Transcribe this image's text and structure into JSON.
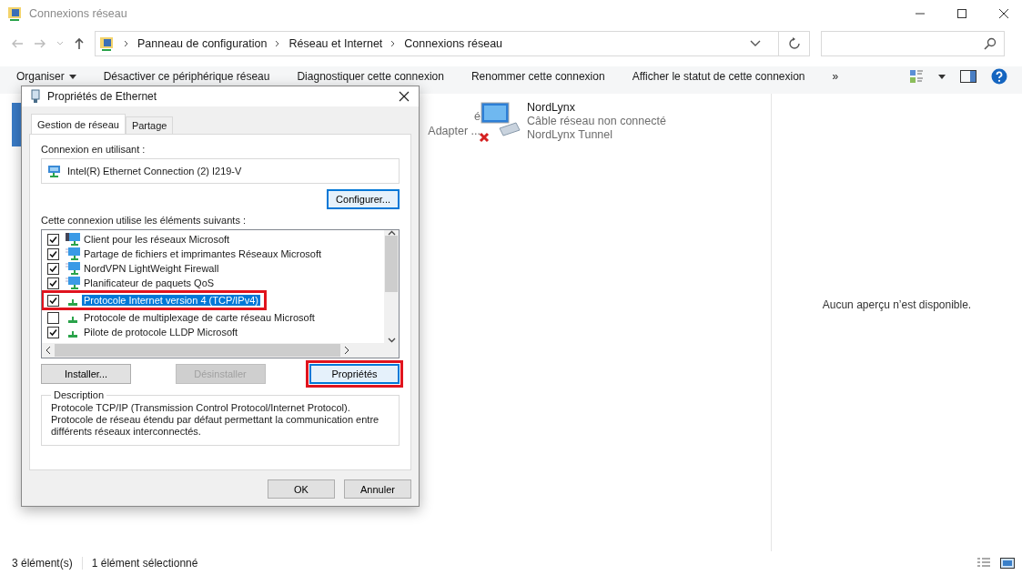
{
  "window": {
    "title": "Connexions réseau"
  },
  "address_bar": {
    "breadcrumbs": [
      "Panneau de configuration",
      "Réseau et Internet",
      "Connexions réseau"
    ]
  },
  "toolbar": {
    "items": [
      "Organiser",
      "Désactiver ce périphérique réseau",
      "Diagnostiquer cette connexion",
      "Renommer cette connexion",
      "Afficher le statut de cette connexion"
    ],
    "more": "»"
  },
  "connections": [
    {
      "kind": "hidden",
      "lines": [
        "é",
        "Adapter ..."
      ]
    },
    {
      "kind": "disconnected",
      "name": "NordLynx",
      "lines": [
        "Câble réseau non connecté",
        "NordLynx Tunnel"
      ]
    }
  ],
  "preview": {
    "message": "Aucun aperçu n’est disponible."
  },
  "status_bar": {
    "count": "3 élément(s)",
    "selection": "1 élément sélectionné"
  },
  "dialog": {
    "title": "Propriétés de Ethernet",
    "tabs": [
      {
        "label": "Gestion de réseau",
        "selected": true
      },
      {
        "label": "Partage",
        "selected": false
      }
    ],
    "adapter_label": "Connexion en utilisant :",
    "adapter": "Intel(R) Ethernet Connection (2) I219-V",
    "configure": "Configurer...",
    "items_label": "Cette connexion utilise les éléments suivants :",
    "items": [
      {
        "kind": "client",
        "label": "Client pour les réseaux Microsoft",
        "checked": true,
        "selected": false
      },
      {
        "kind": "service",
        "label": "Partage de fichiers et imprimantes Réseaux Microsoft",
        "checked": true,
        "selected": false
      },
      {
        "kind": "service",
        "label": "NordVPN LightWeight Firewall",
        "checked": true,
        "selected": false
      },
      {
        "kind": "service",
        "label": "Planificateur de paquets QoS",
        "checked": true,
        "selected": false
      },
      {
        "kind": "protocol",
        "label": "Protocole Internet version 4 (TCP/IPv4)",
        "checked": true,
        "selected": true
      },
      {
        "kind": "protocol",
        "label": "Protocole de multiplexage de carte réseau Microsoft",
        "checked": false,
        "selected": false
      },
      {
        "kind": "protocol",
        "label": "Pilote de protocole LLDP Microsoft",
        "checked": true,
        "selected": false
      }
    ],
    "buttons": [
      {
        "label": "Installer...",
        "disabled": false,
        "highlighted": false
      },
      {
        "label": "Désinstaller",
        "disabled": true,
        "highlighted": false
      },
      {
        "label": "Propriétés",
        "disabled": false,
        "highlighted": true
      }
    ],
    "description_title": "Description",
    "description": "Protocole TCP/IP (Transmission Control Protocol/Internet Protocol). Protocole de réseau étendu par défaut permettant la communication entre différents réseaux interconnectés.",
    "footer_buttons": [
      "OK",
      "Annuler"
    ]
  }
}
